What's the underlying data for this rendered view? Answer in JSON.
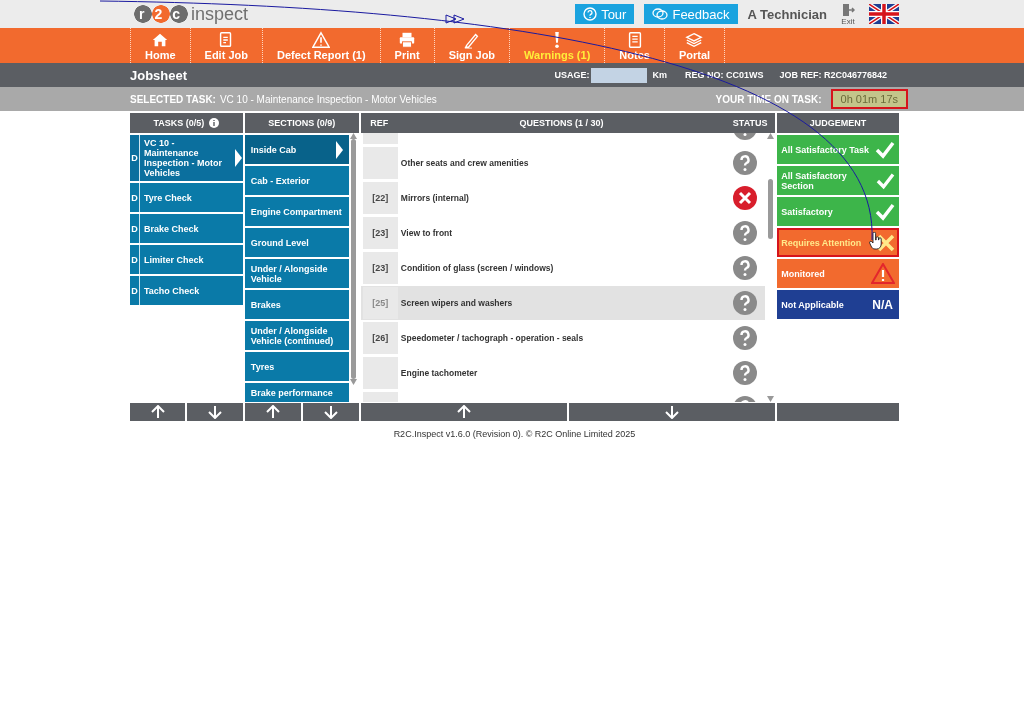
{
  "header": {
    "logo": {
      "mark": "r2c",
      "name": "inspect"
    },
    "tour": "Tour",
    "feedback": "Feedback",
    "user": "A Technician",
    "exit": "Exit"
  },
  "nav": [
    {
      "label": "Home",
      "kind": "home",
      "alert": false
    },
    {
      "label": "Edit Job",
      "kind": "edit",
      "alert": false
    },
    {
      "label": "Defect Report (1)",
      "kind": "warning",
      "alert": false
    },
    {
      "label": "Print",
      "kind": "print",
      "alert": false
    },
    {
      "label": "Sign Job",
      "kind": "sign",
      "alert": false
    },
    {
      "label": "Warnings (1)",
      "kind": "exclaim",
      "alert": true
    },
    {
      "label": "Notes",
      "kind": "notes",
      "alert": false
    },
    {
      "label": "Portal",
      "kind": "portal",
      "alert": false
    }
  ],
  "jobsheet": {
    "title": "Jobsheet",
    "usage_label": "USAGE:",
    "usage_unit": "Km",
    "reg_no": "REG NO: CC01WS",
    "job_ref": "JOB REF: R2C046776842"
  },
  "task_bar": {
    "selected_label": "SELECTED TASK:",
    "selected_task": "VC 10 - Maintenance Inspection - Motor Vehicles",
    "time_label": "YOUR TIME ON TASK:",
    "time": "0h 01m 17s",
    "time_highlighted": true
  },
  "tasks": {
    "header": "TASKS (0/5)",
    "items": [
      {
        "prefix": "D",
        "label": "VC 10 - Maintenance Inspection - Motor Vehicles",
        "selected": true
      },
      {
        "prefix": "D",
        "label": "Tyre Check",
        "selected": false
      },
      {
        "prefix": "D",
        "label": "Brake Check",
        "selected": false
      },
      {
        "prefix": "D",
        "label": "Limiter Check",
        "selected": false
      },
      {
        "prefix": "D",
        "label": "Tacho Check",
        "selected": false
      }
    ]
  },
  "sections": {
    "header": "SECTIONS (0/9)",
    "items": [
      {
        "label": "Inside Cab",
        "selected": true
      },
      {
        "label": "Cab - Exterior",
        "selected": false
      },
      {
        "label": "Engine Compartment",
        "selected": false
      },
      {
        "label": "Ground Level",
        "selected": false
      },
      {
        "label": "Under / Alongside Vehicle",
        "selected": false
      },
      {
        "label": "Brakes",
        "selected": false
      },
      {
        "label": "Under / Alongside Vehicle (continued)",
        "selected": false
      },
      {
        "label": "Tyres",
        "selected": false
      },
      {
        "label": "Brake performance",
        "selected": false
      }
    ]
  },
  "questions": {
    "ref_header": "REF",
    "header": "QUESTIONS (1 / 30)",
    "status_header": "STATUS",
    "rows": [
      {
        "kind": "unknown",
        "selected": false
      },
      {
        "question": "Other seats and crew amenities",
        "kind": "unknown",
        "selected": false
      },
      {
        "ref": "[22]",
        "question": "Mirrors (internal)",
        "kind": "fail",
        "selected": false
      },
      {
        "ref": "[23]",
        "question": "View to front",
        "kind": "unknown",
        "selected": false
      },
      {
        "ref": "[23]",
        "question": "Condition of glass (screen / windows)",
        "kind": "unknown",
        "selected": false
      },
      {
        "ref": "[25]",
        "question": "Screen wipers and washers",
        "kind": "unknown",
        "selected": true
      },
      {
        "ref": "[26]",
        "question": "Speedometer / tachograph - operation - seals",
        "kind": "unknown",
        "selected": false
      },
      {
        "question": "Engine tachometer",
        "kind": "unknown",
        "selected": false
      },
      {
        "kind": "unknown",
        "selected": false
      }
    ]
  },
  "judgement": {
    "header": "JUDGEMENT",
    "items": [
      {
        "label": "All Satisfactory Task",
        "kind": "satisfactory",
        "highlighted": false
      },
      {
        "label": "All Satisfactory Section",
        "kind": "satisfactory",
        "highlighted": false
      },
      {
        "label": "Satisfactory",
        "kind": "satisfactory",
        "highlighted": false
      },
      {
        "label": "Requires Attention",
        "kind": "attention",
        "highlighted": true
      },
      {
        "label": "Monitored",
        "kind": "monitored",
        "highlighted": false
      },
      {
        "label": "Not Applicable",
        "kind": "na",
        "badge": "N/A",
        "highlighted": false
      }
    ]
  },
  "footer": "R2C.Inspect v1.6.0 (Revision 0). © R2C Online Limited 2025"
}
